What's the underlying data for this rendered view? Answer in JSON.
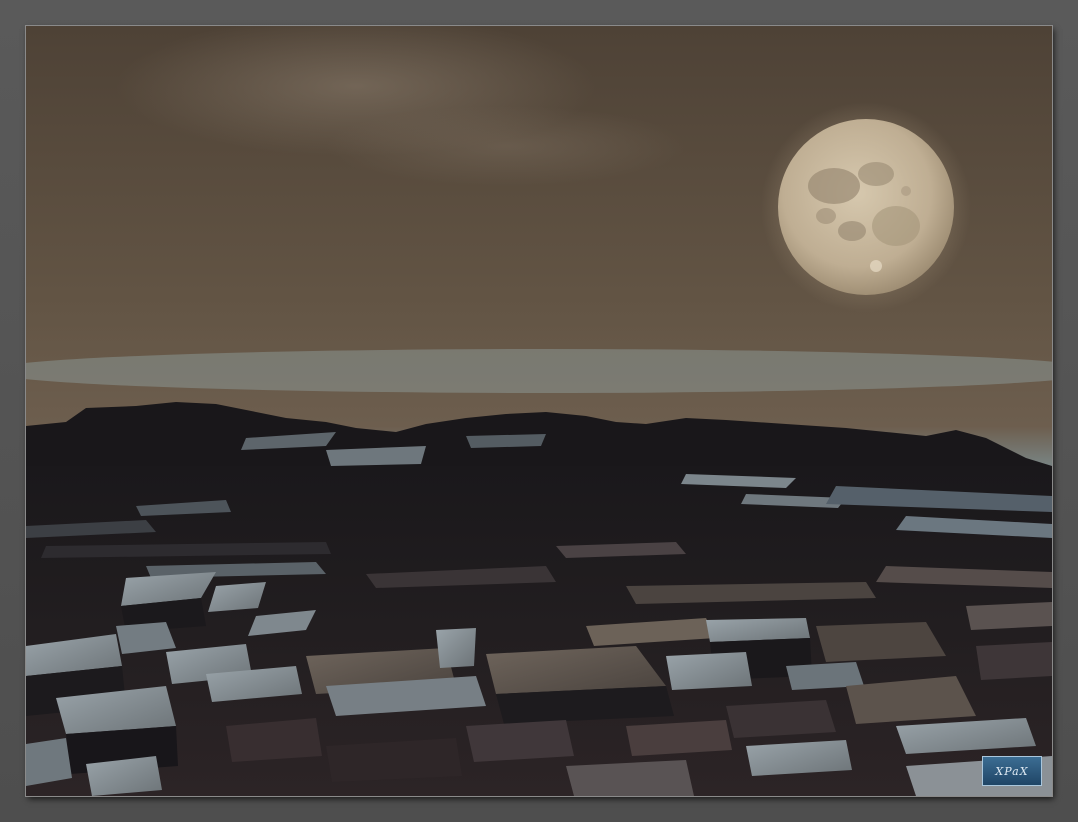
{
  "image": {
    "scene": "moonlit-blocky-terrain",
    "colors": {
      "sky_top": "#4f4337",
      "sky_mid": "#6b5b4a",
      "horizon_haze": "#7f96a0",
      "moon": "#c9b9a0",
      "terrain_dark": "#1c1a1c",
      "terrain_light": "#8f9aa0",
      "frame": "#555555"
    }
  },
  "watermark": {
    "text": "XPaX"
  }
}
